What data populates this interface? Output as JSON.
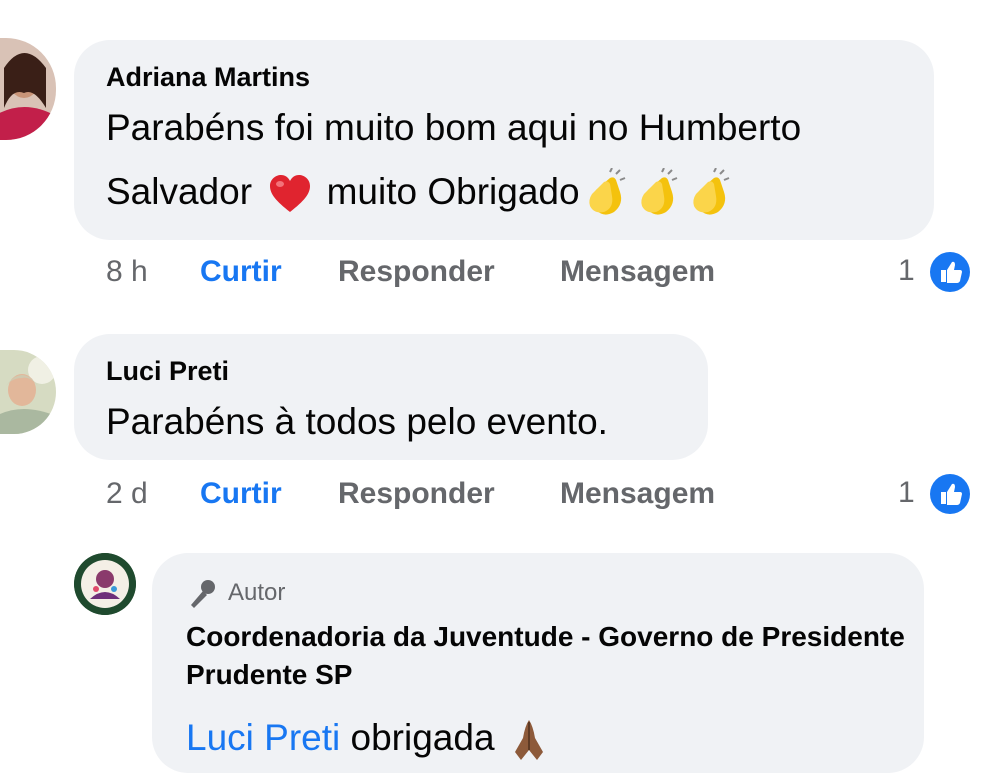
{
  "comments": [
    {
      "author": "Adriana Martins",
      "line1": "Parabéns foi muito bom aqui no Humberto",
      "line2_a": "Salvador",
      "line2_b": "muito Obrigado",
      "time": "8 h",
      "like_label": "Curtir",
      "reply_label": "Responder",
      "message_label": "Mensagem",
      "reaction_count": "1"
    },
    {
      "author": "Luci Preti",
      "text": "Parabéns à todos pelo evento.",
      "time": "2 d",
      "like_label": "Curtir",
      "reply_label": "Responder",
      "message_label": "Mensagem",
      "reaction_count": "1"
    }
  ],
  "reply": {
    "author_badge": "Autor",
    "author": "Coordenadoria da Juventude -  Governo de Presidente Prudente SP",
    "mention": "Luci Preti",
    "text": "obrigada"
  },
  "colors": {
    "bubble": "#f0f2f5",
    "link": "#1877f2",
    "muted": "#65676b"
  }
}
